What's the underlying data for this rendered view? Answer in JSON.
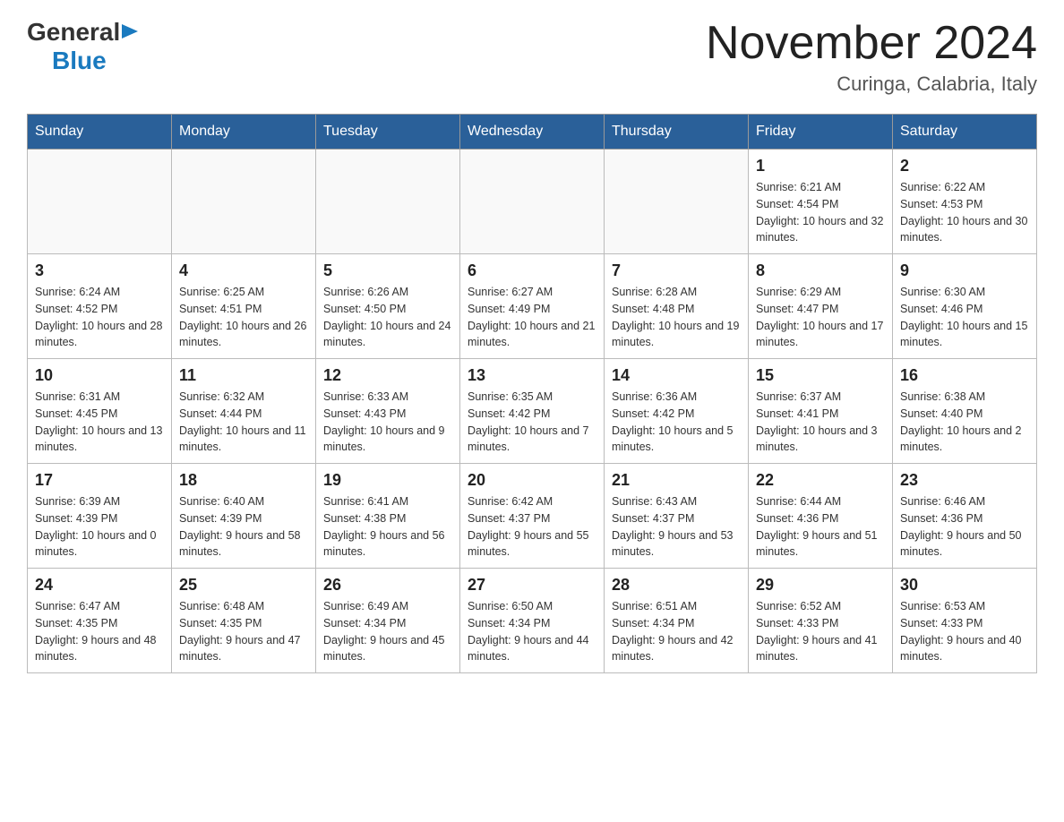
{
  "header": {
    "logo_general": "General",
    "logo_blue": "Blue",
    "month_title": "November 2024",
    "location": "Curinga, Calabria, Italy"
  },
  "weekdays": [
    "Sunday",
    "Monday",
    "Tuesday",
    "Wednesday",
    "Thursday",
    "Friday",
    "Saturday"
  ],
  "weeks": [
    [
      {
        "day": "",
        "sunrise": "",
        "sunset": "",
        "daylight": ""
      },
      {
        "day": "",
        "sunrise": "",
        "sunset": "",
        "daylight": ""
      },
      {
        "day": "",
        "sunrise": "",
        "sunset": "",
        "daylight": ""
      },
      {
        "day": "",
        "sunrise": "",
        "sunset": "",
        "daylight": ""
      },
      {
        "day": "",
        "sunrise": "",
        "sunset": "",
        "daylight": ""
      },
      {
        "day": "1",
        "sunrise": "Sunrise: 6:21 AM",
        "sunset": "Sunset: 4:54 PM",
        "daylight": "Daylight: 10 hours and 32 minutes."
      },
      {
        "day": "2",
        "sunrise": "Sunrise: 6:22 AM",
        "sunset": "Sunset: 4:53 PM",
        "daylight": "Daylight: 10 hours and 30 minutes."
      }
    ],
    [
      {
        "day": "3",
        "sunrise": "Sunrise: 6:24 AM",
        "sunset": "Sunset: 4:52 PM",
        "daylight": "Daylight: 10 hours and 28 minutes."
      },
      {
        "day": "4",
        "sunrise": "Sunrise: 6:25 AM",
        "sunset": "Sunset: 4:51 PM",
        "daylight": "Daylight: 10 hours and 26 minutes."
      },
      {
        "day": "5",
        "sunrise": "Sunrise: 6:26 AM",
        "sunset": "Sunset: 4:50 PM",
        "daylight": "Daylight: 10 hours and 24 minutes."
      },
      {
        "day": "6",
        "sunrise": "Sunrise: 6:27 AM",
        "sunset": "Sunset: 4:49 PM",
        "daylight": "Daylight: 10 hours and 21 minutes."
      },
      {
        "day": "7",
        "sunrise": "Sunrise: 6:28 AM",
        "sunset": "Sunset: 4:48 PM",
        "daylight": "Daylight: 10 hours and 19 minutes."
      },
      {
        "day": "8",
        "sunrise": "Sunrise: 6:29 AM",
        "sunset": "Sunset: 4:47 PM",
        "daylight": "Daylight: 10 hours and 17 minutes."
      },
      {
        "day": "9",
        "sunrise": "Sunrise: 6:30 AM",
        "sunset": "Sunset: 4:46 PM",
        "daylight": "Daylight: 10 hours and 15 minutes."
      }
    ],
    [
      {
        "day": "10",
        "sunrise": "Sunrise: 6:31 AM",
        "sunset": "Sunset: 4:45 PM",
        "daylight": "Daylight: 10 hours and 13 minutes."
      },
      {
        "day": "11",
        "sunrise": "Sunrise: 6:32 AM",
        "sunset": "Sunset: 4:44 PM",
        "daylight": "Daylight: 10 hours and 11 minutes."
      },
      {
        "day": "12",
        "sunrise": "Sunrise: 6:33 AM",
        "sunset": "Sunset: 4:43 PM",
        "daylight": "Daylight: 10 hours and 9 minutes."
      },
      {
        "day": "13",
        "sunrise": "Sunrise: 6:35 AM",
        "sunset": "Sunset: 4:42 PM",
        "daylight": "Daylight: 10 hours and 7 minutes."
      },
      {
        "day": "14",
        "sunrise": "Sunrise: 6:36 AM",
        "sunset": "Sunset: 4:42 PM",
        "daylight": "Daylight: 10 hours and 5 minutes."
      },
      {
        "day": "15",
        "sunrise": "Sunrise: 6:37 AM",
        "sunset": "Sunset: 4:41 PM",
        "daylight": "Daylight: 10 hours and 3 minutes."
      },
      {
        "day": "16",
        "sunrise": "Sunrise: 6:38 AM",
        "sunset": "Sunset: 4:40 PM",
        "daylight": "Daylight: 10 hours and 2 minutes."
      }
    ],
    [
      {
        "day": "17",
        "sunrise": "Sunrise: 6:39 AM",
        "sunset": "Sunset: 4:39 PM",
        "daylight": "Daylight: 10 hours and 0 minutes."
      },
      {
        "day": "18",
        "sunrise": "Sunrise: 6:40 AM",
        "sunset": "Sunset: 4:39 PM",
        "daylight": "Daylight: 9 hours and 58 minutes."
      },
      {
        "day": "19",
        "sunrise": "Sunrise: 6:41 AM",
        "sunset": "Sunset: 4:38 PM",
        "daylight": "Daylight: 9 hours and 56 minutes."
      },
      {
        "day": "20",
        "sunrise": "Sunrise: 6:42 AM",
        "sunset": "Sunset: 4:37 PM",
        "daylight": "Daylight: 9 hours and 55 minutes."
      },
      {
        "day": "21",
        "sunrise": "Sunrise: 6:43 AM",
        "sunset": "Sunset: 4:37 PM",
        "daylight": "Daylight: 9 hours and 53 minutes."
      },
      {
        "day": "22",
        "sunrise": "Sunrise: 6:44 AM",
        "sunset": "Sunset: 4:36 PM",
        "daylight": "Daylight: 9 hours and 51 minutes."
      },
      {
        "day": "23",
        "sunrise": "Sunrise: 6:46 AM",
        "sunset": "Sunset: 4:36 PM",
        "daylight": "Daylight: 9 hours and 50 minutes."
      }
    ],
    [
      {
        "day": "24",
        "sunrise": "Sunrise: 6:47 AM",
        "sunset": "Sunset: 4:35 PM",
        "daylight": "Daylight: 9 hours and 48 minutes."
      },
      {
        "day": "25",
        "sunrise": "Sunrise: 6:48 AM",
        "sunset": "Sunset: 4:35 PM",
        "daylight": "Daylight: 9 hours and 47 minutes."
      },
      {
        "day": "26",
        "sunrise": "Sunrise: 6:49 AM",
        "sunset": "Sunset: 4:34 PM",
        "daylight": "Daylight: 9 hours and 45 minutes."
      },
      {
        "day": "27",
        "sunrise": "Sunrise: 6:50 AM",
        "sunset": "Sunset: 4:34 PM",
        "daylight": "Daylight: 9 hours and 44 minutes."
      },
      {
        "day": "28",
        "sunrise": "Sunrise: 6:51 AM",
        "sunset": "Sunset: 4:34 PM",
        "daylight": "Daylight: 9 hours and 42 minutes."
      },
      {
        "day": "29",
        "sunrise": "Sunrise: 6:52 AM",
        "sunset": "Sunset: 4:33 PM",
        "daylight": "Daylight: 9 hours and 41 minutes."
      },
      {
        "day": "30",
        "sunrise": "Sunrise: 6:53 AM",
        "sunset": "Sunset: 4:33 PM",
        "daylight": "Daylight: 9 hours and 40 minutes."
      }
    ]
  ]
}
